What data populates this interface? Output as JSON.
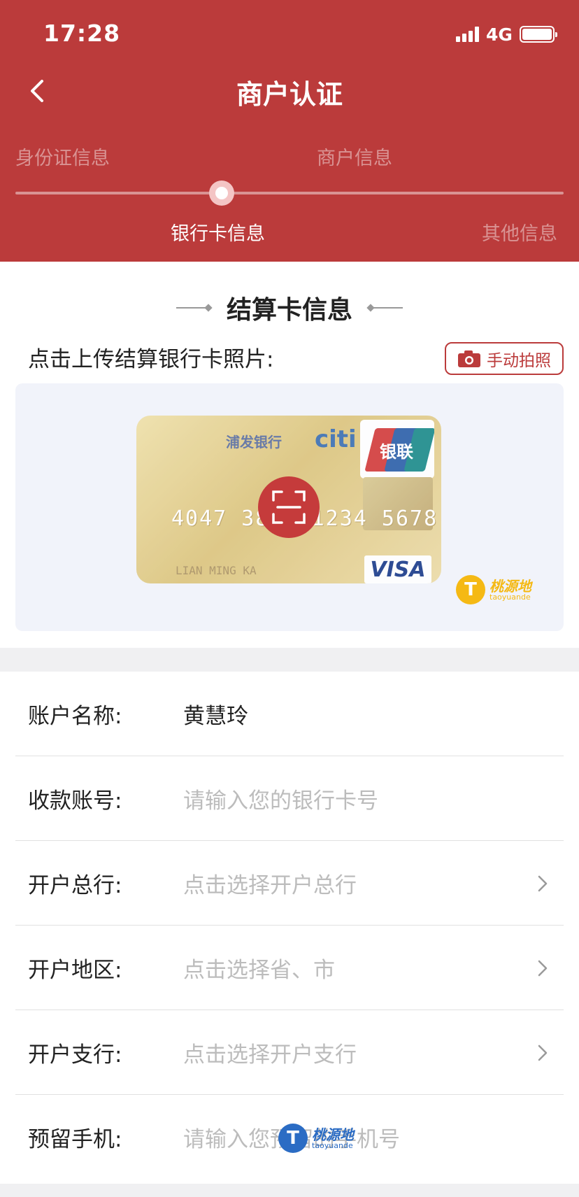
{
  "status_bar": {
    "time": "17:28",
    "network": "4G"
  },
  "header": {
    "title": "商户认证"
  },
  "steps": [
    {
      "label": "身份证信息",
      "state": "done"
    },
    {
      "label": "商户信息",
      "state": "done"
    },
    {
      "label": "银行卡信息",
      "state": "active"
    },
    {
      "label": "其他信息",
      "state": "pending"
    }
  ],
  "section": {
    "title": "结算卡信息"
  },
  "upload": {
    "label": "点击上传结算银行卡照片:",
    "manual_button": "手动拍照"
  },
  "sample_card": {
    "bank": "浦发银行",
    "brand": "citi",
    "network": "银联",
    "number": "4047 3800 1234 5678",
    "name": "LIAN MING KA",
    "scheme": "VISA"
  },
  "watermark": {
    "brand_text": "桃源地",
    "sub": "taoyuande",
    "glyph": "T"
  },
  "form": [
    {
      "label": "账户名称:",
      "value": "黄慧玲",
      "placeholder": "",
      "has_chevron": false
    },
    {
      "label": "收款账号:",
      "value": "",
      "placeholder": "请输入您的银行卡号",
      "has_chevron": false
    },
    {
      "label": "开户总行:",
      "value": "",
      "placeholder": "点击选择开户总行",
      "has_chevron": true
    },
    {
      "label": "开户地区:",
      "value": "",
      "placeholder": "点击选择省、市",
      "has_chevron": true
    },
    {
      "label": "开户支行:",
      "value": "",
      "placeholder": "点击选择开户支行",
      "has_chevron": true
    },
    {
      "label": "预留手机:",
      "value": "",
      "placeholder": "请输入您预留的手机号",
      "has_chevron": false
    }
  ],
  "colors": {
    "primary": "#bb3b3b",
    "placeholder": "#bcbcbc",
    "watermark_yellow": "#f5b914",
    "watermark_blue": "#2b6cc4"
  }
}
